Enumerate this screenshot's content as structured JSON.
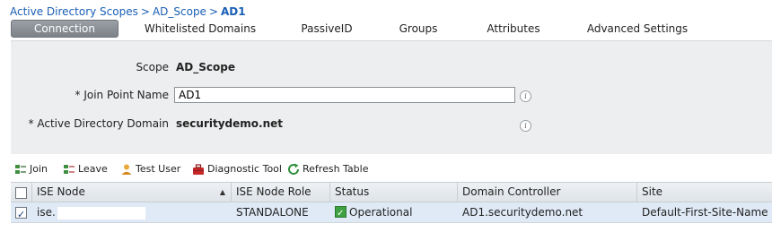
{
  "breadcrumb": {
    "item1": "Active Directory Scopes",
    "item2": "AD_Scope",
    "current": "AD1",
    "separator": ">"
  },
  "tabs": [
    {
      "label": "Connection",
      "active": true
    },
    {
      "label": "Whitelisted Domains",
      "active": false
    },
    {
      "label": "PassiveID",
      "active": false
    },
    {
      "label": "Groups",
      "active": false
    },
    {
      "label": "Attributes",
      "active": false
    },
    {
      "label": "Advanced Settings",
      "active": false
    }
  ],
  "form": {
    "scope_label": "Scope",
    "scope_value": "AD_Scope",
    "join_point_label": "* Join Point Name",
    "join_point_value": "AD1",
    "domain_label": "* Active Directory Domain",
    "domain_value": "securitydemo.net",
    "info_glyph": "i"
  },
  "toolbar": {
    "join": "Join",
    "leave": "Leave",
    "test_user": "Test User",
    "diagnostic_tool": "Diagnostic Tool",
    "refresh_table": "Refresh Table"
  },
  "table": {
    "columns": [
      "ISE Node",
      "ISE Node Role",
      "Status",
      "Domain Controller",
      "Site"
    ],
    "rows": [
      {
        "checked": true,
        "node": "ise.",
        "role": "STANDALONE",
        "status": "Operational",
        "domain_controller": "AD1.securitydemo.net",
        "site": "Default-First-Site-Name"
      }
    ]
  },
  "colors": {
    "link": "#1a5fb4",
    "active_tab": "#868c92",
    "panel_bg": "#eceeef",
    "row_selected": "#dfeaf6",
    "status_ok": "#3fa142"
  }
}
